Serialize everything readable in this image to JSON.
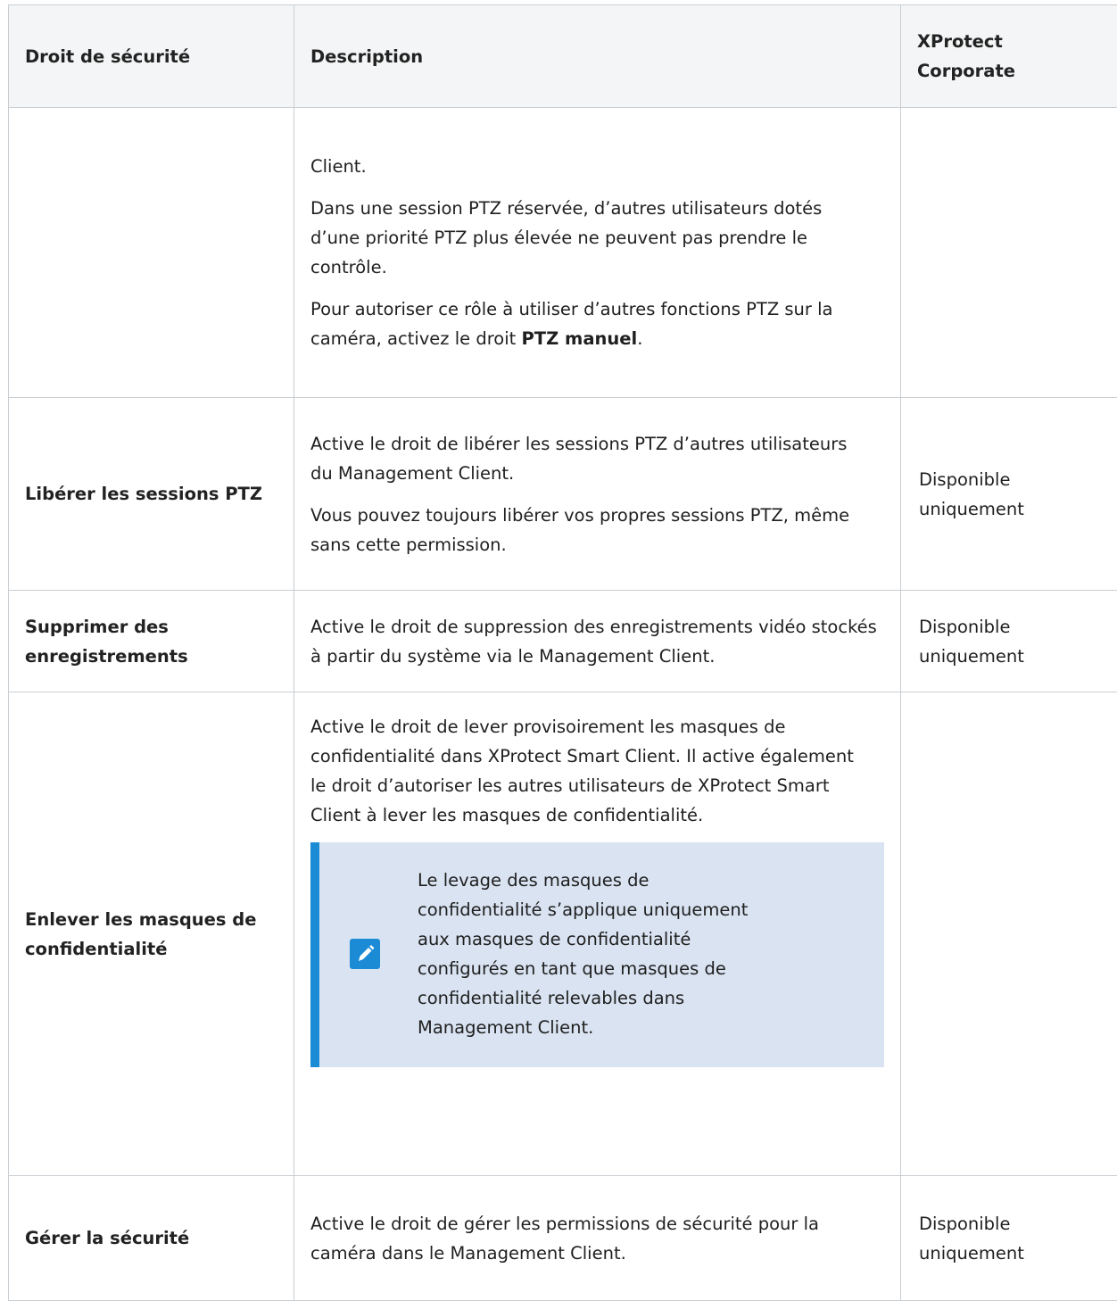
{
  "headers": {
    "col1": "Droit de sécurité",
    "col2": "Description",
    "col3_line1": "XProtect",
    "col3_line2": "Corporate"
  },
  "rows": [
    {
      "name": "",
      "desc": [
        "Client.",
        "Dans une session PTZ réservée, d’autres utilisateurs dotés d’une priorité PTZ plus élevée ne peuvent pas prendre le contrôle."
      ],
      "desc_rich": {
        "before": "Pour autoriser ce rôle à utiliser d’autres fonctions PTZ sur la caméra, activez le droit ",
        "bold": "PTZ manuel",
        "after": "."
      },
      "availability": ""
    },
    {
      "name": "Libérer les sessions PTZ",
      "desc": [
        "Active le droit de libérer les sessions PTZ d’autres utilisateurs du Management Client.",
        "Vous pouvez toujours libérer vos propres sessions PTZ, même sans cette permission."
      ],
      "availability_line1": "Disponible",
      "availability_line2": "uniquement"
    },
    {
      "name_line1": "Supprimer des",
      "name_line2": "enregistrements",
      "desc": [
        "Active le droit de suppression des enregistrements vidéo stockés à partir du système via le Management Client."
      ],
      "availability_line1": "Disponible",
      "availability_line2": "uniquement"
    },
    {
      "name_line1": "Enlever les masques de",
      "name_line2": "confidentialité",
      "desc": [
        "Active le droit de lever provisoirement les masques de confidentialité dans XProtect Smart Client. Il active également le droit d’autoriser les autres utilisateurs de XProtect Smart Client à lever les masques de confidentialité."
      ],
      "note": "Le levage des masques de confidentialité s’applique uniquement aux masques de confidentialité configurés en tant que masques de confidentialité relevables dans Management Client.",
      "note_icon": "pencil-icon",
      "availability": ""
    },
    {
      "name": "Gérer la sécurité",
      "desc": [
        "Active le droit de gérer les permissions de sécurité pour la caméra dans le Management Client."
      ],
      "availability_line1": "Disponible",
      "availability_line2": "uniquement"
    }
  ],
  "colors": {
    "note_bg": "#d9e3f1",
    "accent": "#1b8bd6",
    "border": "#c9ced3",
    "header_bg": "#f4f5f6"
  }
}
